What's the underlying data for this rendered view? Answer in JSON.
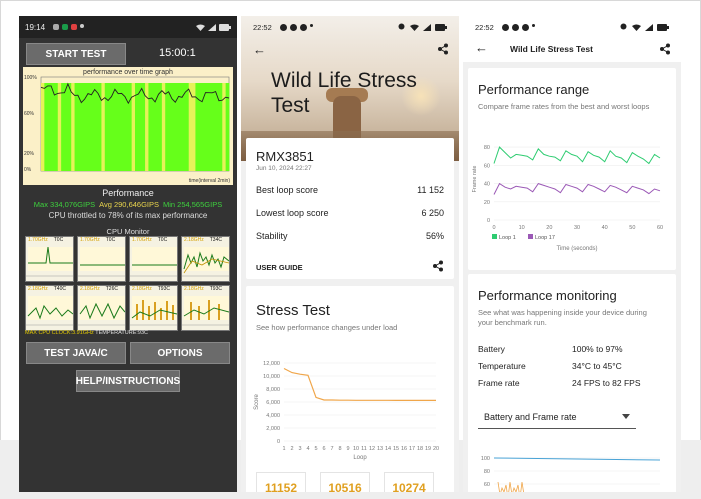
{
  "phone1": {
    "status_time": "19:14",
    "start_test": "START TEST",
    "timer": "15:00:1",
    "chart_title": "performance over time graph",
    "y_top": "100%",
    "y_mid": "60%",
    "y_low": "20%",
    "y_bottom": "0%",
    "x_label": "time(interval 2min)",
    "performance_label": "Performance",
    "max": "Max 334,076GIPS",
    "avg": "Avg 290,646GIPS",
    "min": "Min 254,565GIPS",
    "throttled": "CPU throttled to 78% of its max performance",
    "cpu_monitor": "CPU Monitor",
    "cores": [
      {
        "freq": "1.70GHz",
        "temp": "T0C"
      },
      {
        "freq": "1.70GHz",
        "temp": "T0C"
      },
      {
        "freq": "1.70GHz",
        "temp": "T0C"
      },
      {
        "freq": "2.18GHz",
        "temp": "T34C"
      },
      {
        "freq": "2.18GHz",
        "temp": "T40C"
      },
      {
        "freq": "2.18GHz",
        "temp": "T26C"
      },
      {
        "freq": "2.18GHz",
        "temp": "T93C"
      },
      {
        "freq": "2.18GHz",
        "temp": "T93C"
      }
    ],
    "max_clock": "MAX CPU CLOCK:3.91GHz",
    "temperature": "TEMPERATURE:93C",
    "test_java": "TEST JAVA/C",
    "options": "OPTIONS",
    "help": "HELP/INSTRUCTIONS",
    "colors": {
      "bar_green": "#66ff1a",
      "bar_yellow": "#e6f25a",
      "chart_bg": "#fbf0c8"
    }
  },
  "phone2": {
    "status_time": "22:52",
    "hero_title": "Wild Life Stress Test",
    "device": "RMX3851",
    "date": "Jun 10, 2024 22:27",
    "best_label": "Best loop score",
    "best_value": "11 152",
    "lowest_label": "Lowest loop score",
    "lowest_value": "6 250",
    "stability_label": "Stability",
    "stability_value": "56%",
    "user_guide": "USER GUIDE",
    "stress_title": "Stress Test",
    "stress_sub": "See how performance changes under load",
    "y_axis_label": "Score",
    "x_axis_label": "Loop",
    "y_ticks": [
      "12,000",
      "10,000",
      "8,000",
      "6,000",
      "4,000",
      "2,000",
      "0"
    ],
    "x_ticks": [
      "1",
      "2",
      "3",
      "4",
      "5",
      "6",
      "7",
      "8",
      "9",
      "10",
      "11",
      "12",
      "13",
      "14",
      "15",
      "16",
      "17",
      "18",
      "19",
      "20"
    ],
    "boxes": [
      "11152",
      "10516",
      "10274"
    ]
  },
  "phone3": {
    "status_time": "22:52",
    "title": "Wild Life Stress Test",
    "range_title": "Performance range",
    "range_sub": "Compare frame rates from the best and worst loops",
    "y_axis_label": "Frame rate",
    "x_axis_label": "Time (seconds)",
    "y_ticks": [
      "80",
      "60",
      "40",
      "20",
      "0"
    ],
    "x_ticks": [
      "0",
      "10",
      "20",
      "30",
      "40",
      "50",
      "60"
    ],
    "legend": [
      "Loop 1",
      "Loop 17"
    ],
    "monitor_title": "Performance monitoring",
    "monitor_sub": "See what was happening inside your device during your benchmark run.",
    "battery_label": "Battery",
    "battery_value": "100% to 97%",
    "temperature_label": "Temperature",
    "temperature_value": "34°C to 45°C",
    "framerate_label": "Frame rate",
    "framerate_value": "24 FPS to 82 FPS",
    "dropdown_value": "Battery and Frame rate",
    "mini_ticks": [
      "100",
      "80",
      "60"
    ],
    "colors": {
      "loop1": "#2ecc71",
      "loop17": "#9b59b6"
    }
  },
  "chart_data": [
    {
      "type": "line",
      "title": "",
      "xlabel": "Loop",
      "ylabel": "Score",
      "x": [
        1,
        2,
        3,
        4,
        5,
        6,
        7,
        8,
        9,
        10,
        11,
        12,
        13,
        14,
        15,
        16,
        17,
        18,
        19,
        20
      ],
      "series": [
        {
          "values": [
            11152,
            10516,
            10274,
            10100,
            6700,
            6300,
            6300,
            6280,
            6270,
            6260,
            6260,
            6260,
            6255,
            6255,
            6250,
            6250,
            6250,
            6250,
            6250,
            6250
          ]
        }
      ],
      "ylim": [
        0,
        12000
      ]
    },
    {
      "type": "line",
      "title": "",
      "xlabel": "Time (seconds)",
      "ylabel": "Frame rate",
      "x": [
        0,
        2,
        4,
        6,
        8,
        10,
        12,
        14,
        16,
        18,
        20,
        22,
        24,
        26,
        28,
        30,
        32,
        34,
        36,
        38,
        40,
        42,
        44,
        46,
        48,
        50,
        52,
        54,
        56,
        58,
        60
      ],
      "series": [
        {
          "name": "Loop 1",
          "values": [
            62,
            80,
            74,
            68,
            72,
            71,
            70,
            66,
            78,
            72,
            70,
            69,
            65,
            76,
            72,
            70,
            64,
            75,
            71,
            69,
            64,
            76,
            70,
            68,
            63,
            74,
            70,
            67,
            62,
            72,
            68
          ]
        },
        {
          "name": "Loop 17",
          "values": [
            28,
            40,
            36,
            34,
            37,
            36,
            35,
            31,
            40,
            38,
            36,
            34,
            30,
            39,
            37,
            35,
            31,
            39,
            37,
            34,
            31,
            38,
            36,
            33,
            30,
            37,
            35,
            33,
            29,
            34,
            32
          ]
        }
      ],
      "ylim": [
        0,
        90
      ]
    }
  ]
}
